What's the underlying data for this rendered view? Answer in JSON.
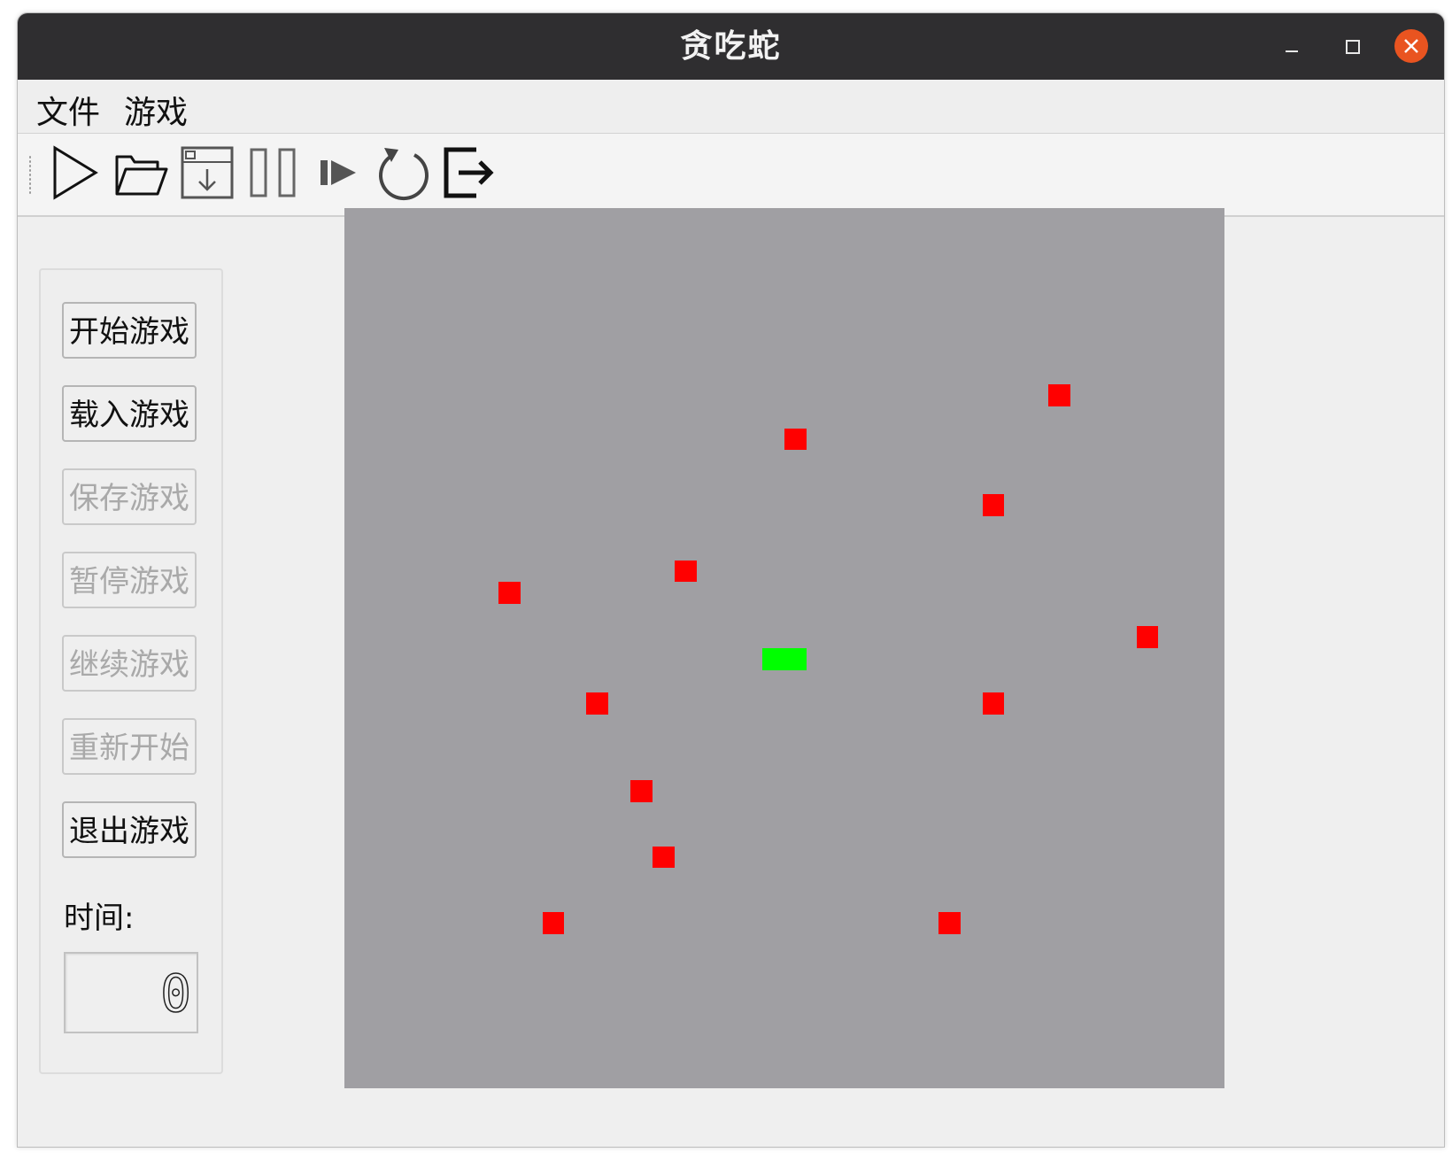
{
  "window": {
    "title": "贪吃蛇"
  },
  "menu": {
    "items": [
      "文件",
      "游戏"
    ]
  },
  "toolbar": {
    "icons": [
      "play-icon",
      "open-folder-icon",
      "save-icon",
      "pause-icon",
      "resume-icon",
      "restart-icon",
      "exit-icon"
    ]
  },
  "sidebar": {
    "buttons": [
      {
        "label": "开始游戏",
        "enabled": true
      },
      {
        "label": "载入游戏",
        "enabled": true
      },
      {
        "label": "保存游戏",
        "enabled": false
      },
      {
        "label": "暂停游戏",
        "enabled": false
      },
      {
        "label": "继续游戏",
        "enabled": false
      },
      {
        "label": "重新开始",
        "enabled": false
      },
      {
        "label": "退出游戏",
        "enabled": true
      }
    ],
    "time_label": "时间:",
    "time_value": "0"
  },
  "board": {
    "grid_size": 40,
    "background": "#a09fa3",
    "obstacle_color": "#ff0000",
    "snake_color": "#00ff00",
    "obstacles": [
      [
        32,
        8
      ],
      [
        20,
        10
      ],
      [
        29,
        13
      ],
      [
        15,
        16
      ],
      [
        7,
        17
      ],
      [
        36,
        19
      ],
      [
        11,
        22
      ],
      [
        29,
        22
      ],
      [
        13,
        26
      ],
      [
        14,
        29
      ],
      [
        9,
        32
      ],
      [
        27,
        32
      ]
    ],
    "snake": [
      [
        19,
        20
      ],
      [
        20,
        20
      ]
    ]
  },
  "colors": {
    "titlebar": "#2f2e30",
    "close_button": "#e95420"
  }
}
